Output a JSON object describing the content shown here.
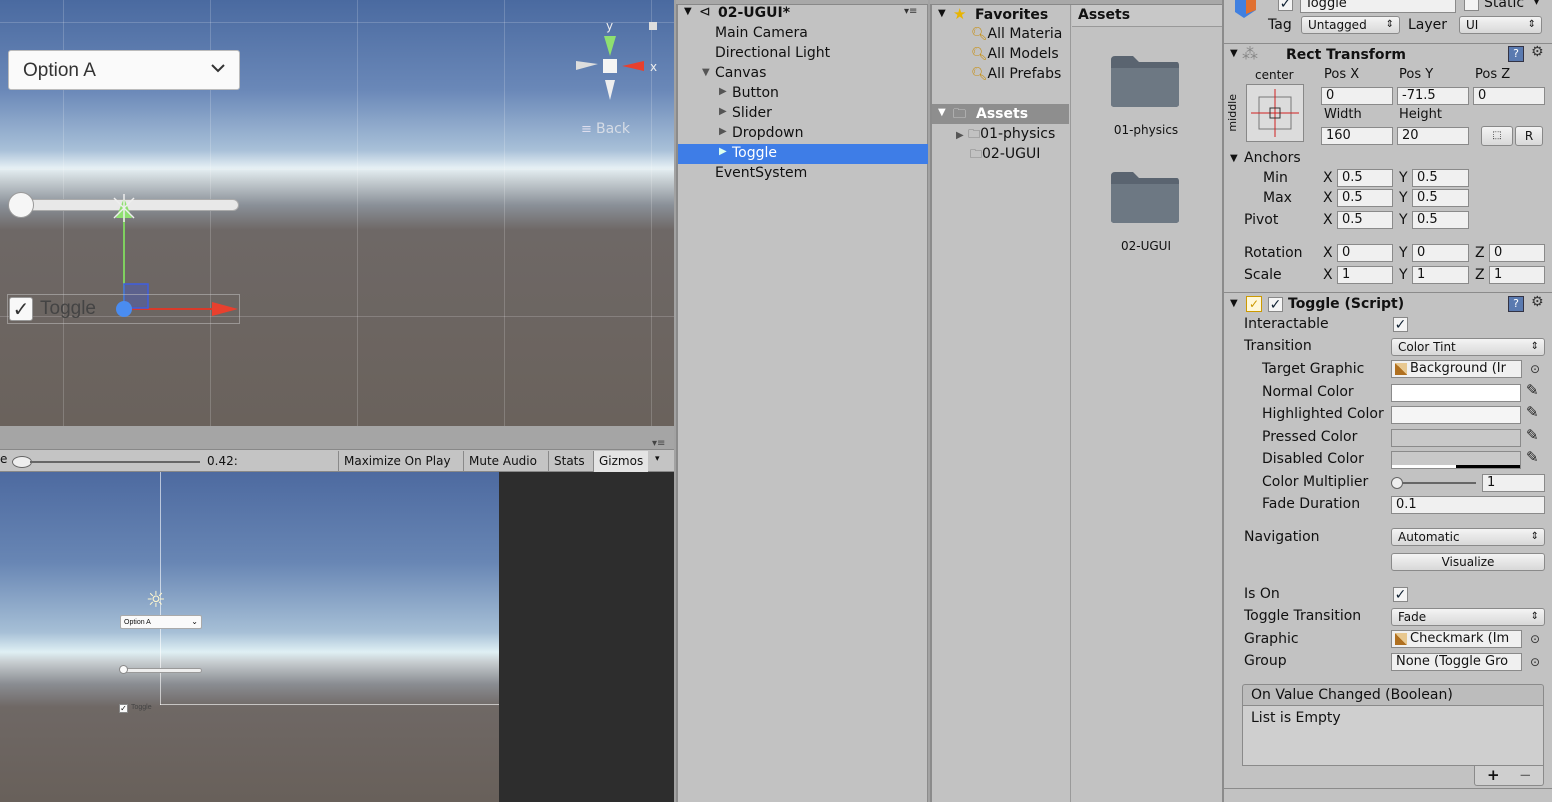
{
  "scene": {
    "dropdown_value": "Option A",
    "toggle_label": "Toggle",
    "back_label": "Back",
    "gizmo_axes": {
      "y": "y",
      "x": "x"
    }
  },
  "game_toolbar": {
    "scale_prefix": "e",
    "scale_value": "0.42:",
    "buttons": [
      "Maximize On Play",
      "Mute Audio",
      "Stats",
      "Gizmos"
    ]
  },
  "game_view": {
    "dropdown_value": "Option A",
    "toggle_label": "Toggle"
  },
  "hierarchy": {
    "scene_name": "02-UGUI*",
    "items": [
      {
        "label": "Main Camera"
      },
      {
        "label": "Directional Light"
      },
      {
        "label": "Canvas"
      },
      {
        "label": "Button"
      },
      {
        "label": "Slider"
      },
      {
        "label": "Dropdown"
      },
      {
        "label": "Toggle",
        "selected": true
      },
      {
        "label": "EventSystem"
      }
    ]
  },
  "project": {
    "favorites_header": "Favorites",
    "favorites": [
      "All Materia",
      "All Models",
      "All Prefabs"
    ],
    "assets_header": "Assets",
    "assets_tree": [
      "01-physics",
      "02-UGUI"
    ],
    "grid_header": "Assets",
    "grid_items": [
      "01-physics",
      "02-UGUI"
    ]
  },
  "inspector": {
    "object_name": "Toggle",
    "static_label": "Static",
    "tag_label": "Tag",
    "tag_value": "Untagged",
    "layer_label": "Layer",
    "layer_value": "UI",
    "rect_transform": {
      "title": "Rect Transform",
      "anchor_h": "center",
      "anchor_v": "middle",
      "pos_x_label": "Pos X",
      "pos_y_label": "Pos Y",
      "pos_z_label": "Pos Z",
      "pos_x": "0",
      "pos_y": "-71.5",
      "pos_z": "0",
      "width_label": "Width",
      "height_label": "Height",
      "width": "160",
      "height": "20",
      "r_button": "R",
      "anchors_label": "Anchors",
      "min_label": "Min",
      "max_label": "Max",
      "pivot_label": "Pivot",
      "min_x": "0.5",
      "min_y": "0.5",
      "max_x": "0.5",
      "max_y": "0.5",
      "pivot_x": "0.5",
      "pivot_y": "0.5",
      "rotation_label": "Rotation",
      "scale_label": "Scale",
      "rot_x": "0",
      "rot_y": "0",
      "rot_z": "0",
      "scale_x": "1",
      "scale_y": "1",
      "scale_z": "1",
      "axis_x": "X",
      "axis_y": "Y",
      "axis_z": "Z"
    },
    "toggle_script": {
      "title": "Toggle (Script)",
      "interactable_label": "Interactable",
      "transition_label": "Transition",
      "transition_value": "Color Tint",
      "target_graphic_label": "Target Graphic",
      "target_graphic_value": "Background (Ir",
      "normal_color_label": "Normal Color",
      "highlighted_color_label": "Highlighted Color",
      "pressed_color_label": "Pressed Color",
      "disabled_color_label": "Disabled Color",
      "color_multiplier_label": "Color Multiplier",
      "color_multiplier_value": "1",
      "fade_duration_label": "Fade Duration",
      "fade_duration_value": "0.1",
      "navigation_label": "Navigation",
      "navigation_value": "Automatic",
      "visualize_label": "Visualize",
      "is_on_label": "Is On",
      "toggle_transition_label": "Toggle Transition",
      "toggle_transition_value": "Fade",
      "graphic_label": "Graphic",
      "graphic_value": "Checkmark (Im",
      "group_label": "Group",
      "group_value": "None (Toggle Gro",
      "on_value_changed_label": "On Value Changed (Boolean)",
      "list_empty_label": "List is Empty",
      "add_label": "+",
      "remove_label": "−"
    }
  }
}
